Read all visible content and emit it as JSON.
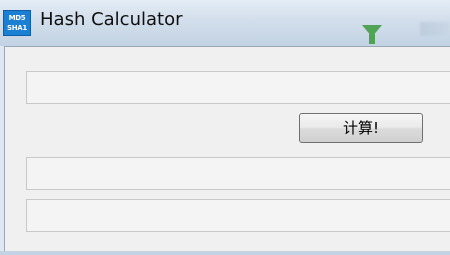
{
  "window": {
    "title": "Hash Calculator",
    "icon": {
      "name": "md5-sha1-app-icon",
      "line1": "MD5",
      "line2": "SHA1",
      "color": "#1b7fd4"
    }
  },
  "form": {
    "input_value": "",
    "calculate_label": "计算!",
    "md5_value": "",
    "sha1_value": ""
  }
}
